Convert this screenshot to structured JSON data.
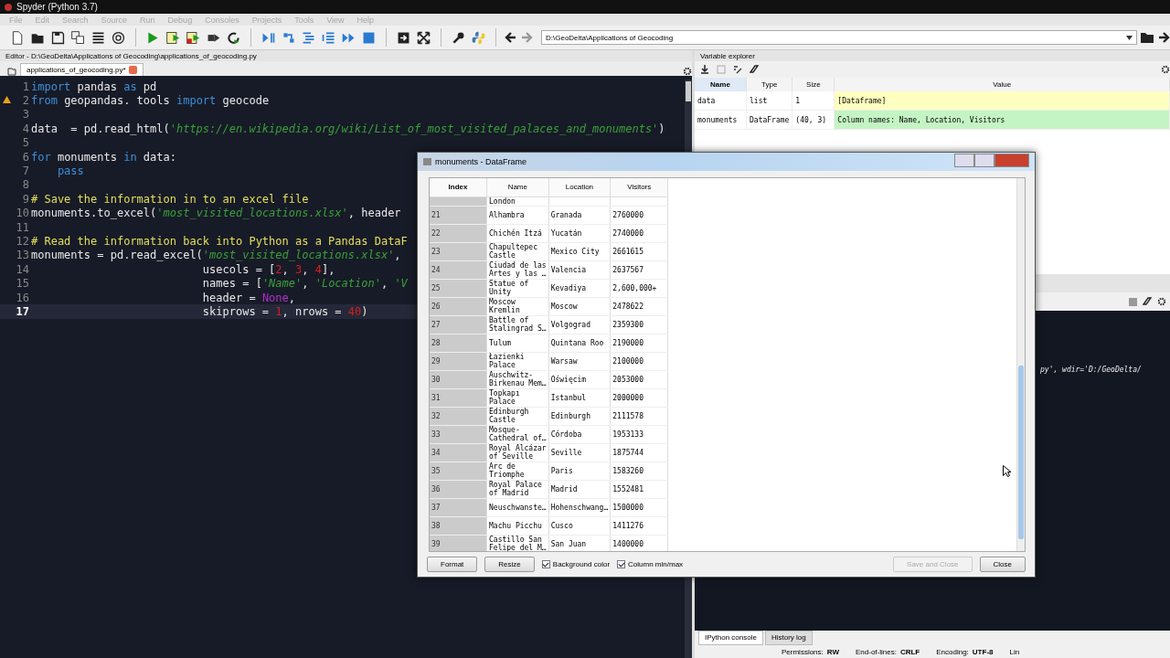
{
  "window": {
    "title": "Spyder (Python 3.7)"
  },
  "menu": [
    "File",
    "Edit",
    "Search",
    "Source",
    "Run",
    "Debug",
    "Consoles",
    "Projects",
    "Tools",
    "View",
    "Help"
  ],
  "toolbar": {
    "path": "D:\\GeoDelta\\Applications of Geocoding"
  },
  "editor": {
    "title": "Editor - D:\\GeoDelta\\Applications of Geocoding\\applications_of_geocoding.py",
    "tabs": [
      {
        "label": "applications_of_geocoding.py*",
        "selected": true
      }
    ],
    "lines": [
      {
        "number": "1",
        "current": false,
        "warning": false,
        "tokens": [
          {
            "kind": "keyword",
            "text": "import"
          },
          {
            "kind": "plain",
            "text": " pandas "
          },
          {
            "kind": "keyword",
            "text": "as"
          },
          {
            "kind": "plain",
            "text": " pd"
          }
        ]
      },
      {
        "number": "2",
        "current": false,
        "warning": true,
        "tokens": [
          {
            "kind": "keyword",
            "text": "from"
          },
          {
            "kind": "plain",
            "text": " geopandas. tools "
          },
          {
            "kind": "keyword",
            "text": "import"
          },
          {
            "kind": "plain",
            "text": " geocode"
          }
        ]
      },
      {
        "number": "3",
        "current": false,
        "warning": false
      },
      {
        "number": "4",
        "current": false,
        "warning": false,
        "tokens": [
          {
            "kind": "plain",
            "text": "data  = pd.read_html("
          },
          {
            "kind": "string",
            "text": "'https://en.wikipedia.org/wiki/List_of_most_visited_palaces_and_monuments'"
          },
          {
            "kind": "plain",
            "text": ")"
          }
        ]
      },
      {
        "number": "5",
        "current": false,
        "warning": false
      },
      {
        "number": "6",
        "current": false,
        "warning": false,
        "tokens": [
          {
            "kind": "keyword",
            "text": "for"
          },
          {
            "kind": "plain",
            "text": " monuments "
          },
          {
            "kind": "keyword",
            "text": "in"
          },
          {
            "kind": "plain",
            "text": " data:"
          }
        ]
      },
      {
        "number": "7",
        "current": false,
        "warning": false,
        "tokens": [
          {
            "kind": "keyword",
            "text": "    pass"
          }
        ]
      },
      {
        "number": "8",
        "current": false,
        "warning": false
      },
      {
        "number": "9",
        "current": false,
        "warning": false,
        "tokens": [
          {
            "kind": "comment",
            "text": "# Save the information in to an excel file"
          }
        ]
      },
      {
        "number": "10",
        "current": false,
        "warning": false,
        "tokens": [
          {
            "kind": "plain",
            "text": "monuments.to_excel("
          },
          {
            "kind": "string",
            "text": "'most_visited_locations.xlsx'"
          },
          {
            "kind": "plain",
            "text": ", header"
          }
        ]
      },
      {
        "number": "11",
        "current": false,
        "warning": false
      },
      {
        "number": "12",
        "current": false,
        "warning": false,
        "tokens": [
          {
            "kind": "comment",
            "text": "# Read the information back into Python as a Pandas DataF"
          }
        ]
      },
      {
        "number": "13",
        "current": false,
        "warning": false,
        "tokens": [
          {
            "kind": "plain",
            "text": "monuments = pd.read_excel("
          },
          {
            "kind": "string",
            "text": "'most_visited_locations.xlsx'"
          },
          {
            "kind": "plain",
            "text": ","
          }
        ]
      },
      {
        "number": "14",
        "current": false,
        "warning": false,
        "tokens": [
          {
            "kind": "plain",
            "text": "                          usecols = ["
          },
          {
            "kind": "number",
            "text": "2"
          },
          {
            "kind": "plain",
            "text": ", "
          },
          {
            "kind": "number",
            "text": "3"
          },
          {
            "kind": "plain",
            "text": ", "
          },
          {
            "kind": "number",
            "text": "4"
          },
          {
            "kind": "plain",
            "text": "],"
          }
        ]
      },
      {
        "number": "15",
        "current": false,
        "warning": false,
        "tokens": [
          {
            "kind": "plain",
            "text": "                          names = ["
          },
          {
            "kind": "string",
            "text": "'Name'"
          },
          {
            "kind": "plain",
            "text": ", "
          },
          {
            "kind": "string",
            "text": "'Location'"
          },
          {
            "kind": "plain",
            "text": ", "
          },
          {
            "kind": "string",
            "text": "'V"
          }
        ]
      },
      {
        "number": "16",
        "current": false,
        "warning": false,
        "tokens": [
          {
            "kind": "plain",
            "text": "                          header = "
          },
          {
            "kind": "constant",
            "text": "None"
          },
          {
            "kind": "plain",
            "text": ","
          }
        ]
      },
      {
        "number": "17",
        "current": true,
        "warning": false,
        "tokens": [
          {
            "kind": "plain",
            "text": "                          skiprows = "
          },
          {
            "kind": "number",
            "text": "1"
          },
          {
            "kind": "plain",
            "text": ", nrows = "
          },
          {
            "kind": "number",
            "text": "40"
          },
          {
            "kind": "plain",
            "text": ")"
          }
        ]
      }
    ]
  },
  "variable_explorer": {
    "title": "Variable explorer",
    "columns": [
      {
        "label": "Name",
        "selected": true
      },
      {
        "label": "Type",
        "selected": false
      },
      {
        "label": "Size",
        "selected": false
      },
      {
        "label": "Value",
        "selected": false
      }
    ],
    "rows": [
      {
        "name": "data",
        "type": "list",
        "size": "1",
        "value": "[Dataframe]",
        "color": "#ffffc0"
      },
      {
        "name": "monuments",
        "type": "DataFrame",
        "size": "(40, 3)",
        "value": "Column names: Name, Location, Visitors",
        "color": "#c4f4c4"
      }
    ]
  },
  "console": {
    "text": "py', wdir='D:/GeoDelta/",
    "tabs": [
      {
        "label": "IPython console",
        "selected": true
      },
      {
        "label": "History log",
        "selected": false
      }
    ]
  },
  "status_bar": [
    {
      "label": "Permissions:",
      "value": "RW"
    },
    {
      "label": "End-of-lines:",
      "value": "CRLF"
    },
    {
      "label": "Encoding:",
      "value": "UTF-8"
    },
    {
      "label": "Lin"
    }
  ],
  "dialog": {
    "title": "monuments - DataFrame",
    "columns": [
      "Index",
      "Name",
      "Location",
      "Visitors"
    ],
    "partial_row": {
      "name": "London"
    },
    "rows": [
      {
        "index": "21",
        "name": "Alhambra",
        "location": "Granada",
        "visitors": "2760000"
      },
      {
        "index": "22",
        "name": "Chichén Itzá",
        "location": "Yucatán",
        "visitors": "2740000"
      },
      {
        "index": "23",
        "name": "Chapultepec\nCastle",
        "location": "Mexico City",
        "visitors": "2661615"
      },
      {
        "index": "24",
        "name": "Ciudad de las\nArtes y las …",
        "location": "Valencia",
        "visitors": "2637567"
      },
      {
        "index": "25",
        "name": "Statue of\nUnity",
        "location": "Kevadiya",
        "visitors": "2,600,000+"
      },
      {
        "index": "26",
        "name": "Moscow\nKremlin",
        "location": "Moscow",
        "visitors": "2478622"
      },
      {
        "index": "27",
        "name": "Battle of\nStalingrad S…",
        "location": "Volgograd",
        "visitors": "2359300"
      },
      {
        "index": "28",
        "name": "Tulum",
        "location": "Quintana Roo",
        "visitors": "2190000"
      },
      {
        "index": "29",
        "name": "Łazienki\nPalace",
        "location": "Warsaw",
        "visitors": "2100000"
      },
      {
        "index": "30",
        "name": "Auschwitz-\nBirkenau Mem…",
        "location": "Oświęcim",
        "visitors": "2053000"
      },
      {
        "index": "31",
        "name": "Topkapı\nPalace",
        "location": "Istanbul",
        "visitors": "2000000"
      },
      {
        "index": "32",
        "name": "Edinburgh\nCastle",
        "location": "Edinburgh",
        "visitors": "2111578"
      },
      {
        "index": "33",
        "name": "Mosque-\nCathedral of…",
        "location": "Córdoba",
        "visitors": "1953133"
      },
      {
        "index": "34",
        "name": "Royal Alcázar\nof Seville",
        "location": "Seville",
        "visitors": "1875744"
      },
      {
        "index": "35",
        "name": "Arc de\nTriomphe",
        "location": "Paris",
        "visitors": "1583260"
      },
      {
        "index": "36",
        "name": "Royal Palace\nof Madrid",
        "location": "Madrid",
        "visitors": "1552481"
      },
      {
        "index": "37",
        "name": "Neuschwanste…",
        "location": "Hohenschwang…",
        "visitors": "1500000"
      },
      {
        "index": "38",
        "name": "Machu Picchu",
        "location": "Cusco",
        "visitors": "1411276"
      },
      {
        "index": "39",
        "name": "Castillo San\nFelipe del M…",
        "location": "San Juan",
        "visitors": "1400000"
      }
    ],
    "buttons": [
      {
        "label": "Format",
        "disabled": false
      },
      {
        "label": "Resize",
        "disabled": false
      }
    ],
    "checkboxes": [
      {
        "label": "Background color",
        "checked": true
      },
      {
        "label": "Column min/max",
        "checked": true
      }
    ],
    "actions": [
      {
        "label": "Save and Close",
        "disabled": true
      },
      {
        "label": "Close",
        "disabled": false
      }
    ]
  }
}
